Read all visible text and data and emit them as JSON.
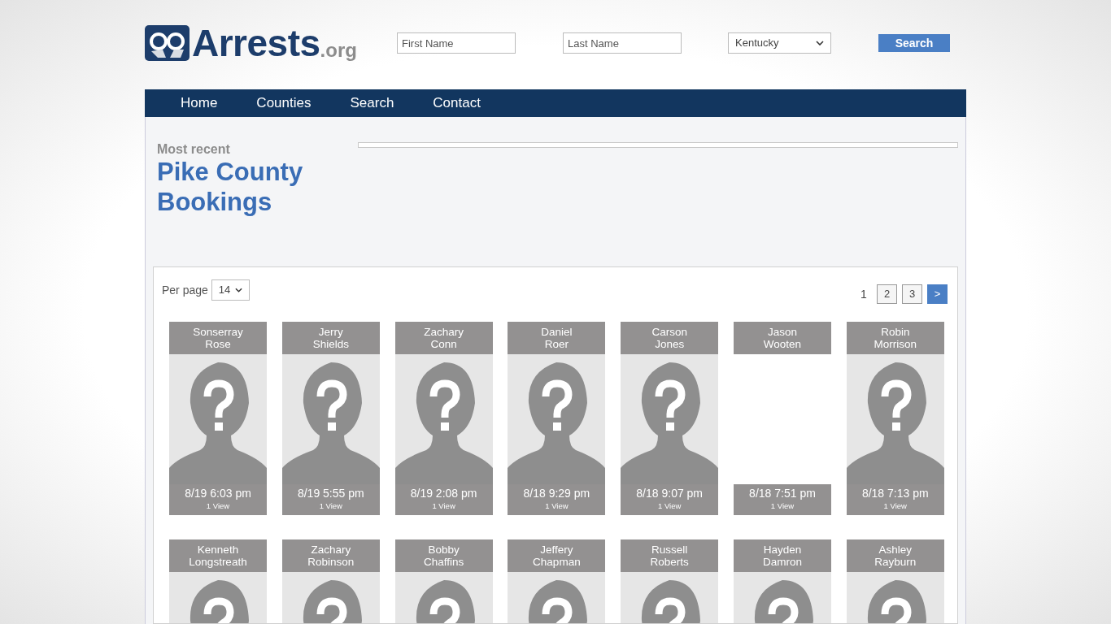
{
  "logo": {
    "name": "Arrests",
    "suffix": ".org"
  },
  "search": {
    "first_name": {
      "placeholder": "First Name"
    },
    "last_name": {
      "placeholder": "Last Name"
    },
    "state": {
      "value": "Kentucky"
    },
    "button": "Search"
  },
  "nav": [
    "Home",
    "Counties",
    "Search",
    "Contact"
  ],
  "heading": {
    "overline": "Most recent",
    "title": "Pike County Bookings"
  },
  "per_page": {
    "label": "Per page",
    "value": "14"
  },
  "pagination": [
    {
      "label": "1",
      "selected": true
    },
    {
      "label": "2",
      "selected": false
    },
    {
      "label": "3",
      "selected": false
    },
    {
      "label": ">",
      "selected": false,
      "kind": "next"
    }
  ],
  "bookings": [
    {
      "first": "Sonserray",
      "last": "Rose",
      "has_photo": true,
      "time": "8/19 6:03 pm",
      "views": "1 View"
    },
    {
      "first": "Jerry",
      "last": "Shields",
      "has_photo": true,
      "time": "8/19 5:55 pm",
      "views": "1 View"
    },
    {
      "first": "Zachary",
      "last": "Conn",
      "has_photo": true,
      "time": "8/19 2:08 pm",
      "views": "1 View"
    },
    {
      "first": "Daniel",
      "last": "Roer",
      "has_photo": true,
      "time": "8/18 9:29 pm",
      "views": "1 View"
    },
    {
      "first": "Carson",
      "last": "Jones",
      "has_photo": true,
      "time": "8/18 9:07 pm",
      "views": "1 View"
    },
    {
      "first": "Jason",
      "last": "Wooten",
      "has_photo": false,
      "time": "8/18 7:51 pm",
      "views": "1 View"
    },
    {
      "first": "Robin",
      "last": "Morrison",
      "has_photo": true,
      "time": "8/18 7:13 pm",
      "views": "1 View"
    },
    {
      "first": "Kenneth",
      "last": "Longstreath",
      "has_photo": true
    },
    {
      "first": "Zachary",
      "last": "Robinson",
      "has_photo": true
    },
    {
      "first": "Bobby",
      "last": "Chaffins",
      "has_photo": true
    },
    {
      "first": "Jeffery",
      "last": "Chapman",
      "has_photo": true
    },
    {
      "first": "Russell",
      "last": "Roberts",
      "has_photo": true
    },
    {
      "first": "Hayden",
      "last": "Damron",
      "has_photo": true
    },
    {
      "first": "Ashley",
      "last": "Rayburn",
      "has_photo": true
    }
  ]
}
